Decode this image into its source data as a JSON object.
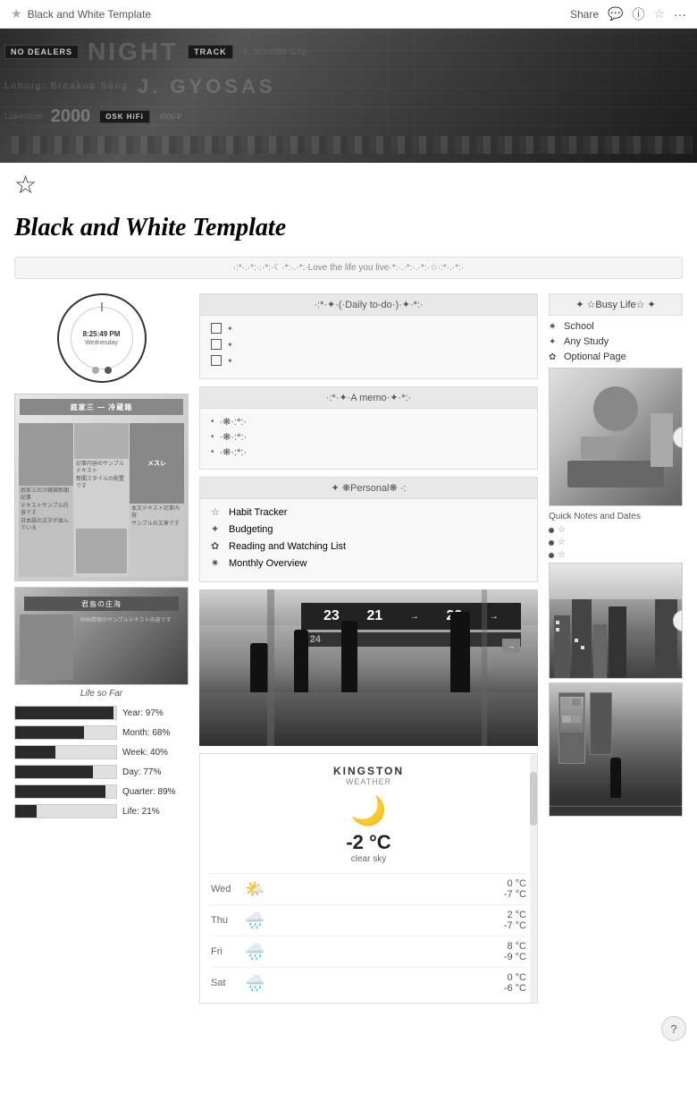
{
  "topbar": {
    "title": "Black and White Template",
    "share_label": "Share",
    "favicon": "★"
  },
  "hero": {
    "strips": [
      "NO DEALERS",
      "NIGHT TRACK",
      "3. Scoville City",
      "Lohnig: Breakup Song",
      "J. GYOSAS",
      "Lakeview",
      "2000",
      "OSK HiFi"
    ]
  },
  "page": {
    "star": "☆",
    "title": "Black and White Template",
    "deco_line": "·:*·.·*:·.·*:·☾·*:·.·*:·Love the life you live·*:·.·*:·.·*:·☆·:*·.·*:·"
  },
  "clock": {
    "time": "8:25:49 PM",
    "day": "Wednesday"
  },
  "progress_bars": [
    {
      "label": "Year: 97%",
      "value": 97
    },
    {
      "label": "Month: 68%",
      "value": 68
    },
    {
      "label": "Week: 40%",
      "value": 40
    },
    {
      "label": "Day: 77%",
      "value": 77
    },
    {
      "label": "Quarter: 89%",
      "value": 89
    },
    {
      "label": "Life: 21%",
      "value": 21
    }
  ],
  "caption": "Life so Far",
  "daily_todo": {
    "header": "·:*·✦·(·Daily to-do·)·✦·*:·",
    "items": [
      "✦",
      "✦",
      "✦"
    ]
  },
  "memo": {
    "header": "·:*·✦·A memo·✦·*:·",
    "items": [
      "·❋·:*:·",
      "·❋·:*:·",
      "·❋·:*:·"
    ]
  },
  "personal": {
    "header": "✦ ❋Personal❋ ·:",
    "items": [
      {
        "icon": "☆",
        "label": "Habit Tracker"
      },
      {
        "icon": "✦",
        "label": "Budgeting"
      },
      {
        "icon": "✿",
        "label": "Reading and Watching List"
      },
      {
        "icon": "✷",
        "label": "Monthly Overview"
      }
    ]
  },
  "busy_life": {
    "header": "✦ ☆Busy Life☆ ✦",
    "items": [
      {
        "icon": "✷",
        "label": "School"
      },
      {
        "icon": "✦",
        "label": "Any Study"
      },
      {
        "icon": "✿",
        "label": "Optional Page"
      }
    ]
  },
  "quick_notes": {
    "label": "Quick Notes and Dates",
    "items": [
      "☆",
      "☆",
      "☆"
    ]
  },
  "weather": {
    "city": "KINGSTON",
    "label": "WEATHER",
    "icon": "🌙",
    "temp": "-2 °C",
    "desc": "clear sky",
    "forecast": [
      {
        "day": "Wed",
        "icon": "🌤️",
        "high": "0 °C",
        "low": "-7 °C"
      },
      {
        "day": "Thu",
        "icon": "🌧️",
        "high": "2 °C",
        "low": "-7 °C"
      },
      {
        "day": "Fri",
        "icon": "🌧️",
        "high": "8 °C",
        "low": "-9 °C"
      },
      {
        "day": "Sat",
        "icon": "🌧️",
        "high": "0 °C",
        "low": "-6 °C"
      }
    ]
  },
  "help": "?"
}
